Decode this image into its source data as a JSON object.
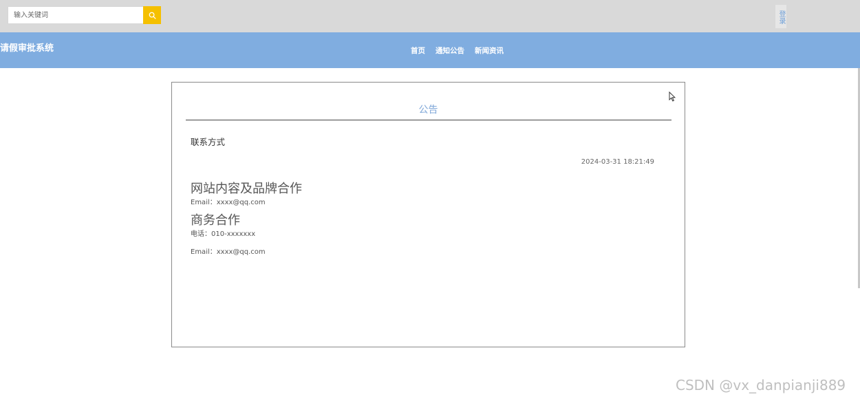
{
  "header": {
    "search": {
      "placeholder": "输入关键词",
      "value": ""
    },
    "search_icon": "search-icon",
    "login_label": "登录"
  },
  "navbar": {
    "site_title": "请假审批系统",
    "items": [
      {
        "label": "首页"
      },
      {
        "label": "通知公告"
      },
      {
        "label": "新闻资讯"
      }
    ]
  },
  "notice": {
    "section_title": "公告",
    "title": "联系方式",
    "time": "2024-03-31 18:21:49",
    "content": {
      "heading1": "网站内容及品牌合作",
      "line1": "Email：xxxx@qq.com",
      "heading2": "商务合作",
      "line2": "电话：010-xxxxxxx",
      "line3": "Email：xxxx@qq.com"
    }
  },
  "watermark": "CSDN @vx_danpianji889",
  "colors": {
    "topbar": "#d9d9d9",
    "navbar": "#80ade0",
    "search_button": "#f5c000",
    "accent_text": "#7fa7d8"
  }
}
